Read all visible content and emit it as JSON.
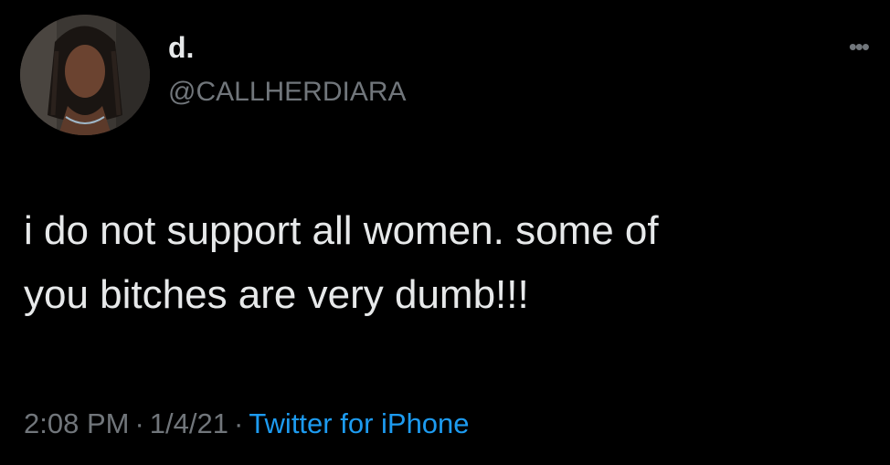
{
  "author": {
    "display_name": "d.",
    "handle": "@CALLHERDIARA"
  },
  "tweet": {
    "text": "i do not support all women. some of\nyou bitches are very dumb!!!",
    "time": "2:08 PM",
    "date": "1/4/21",
    "separator": "·",
    "source": "Twitter for iPhone"
  },
  "icons": {
    "more": "more-options-icon"
  },
  "colors": {
    "background": "#000000",
    "primary_text": "#e7e9ea",
    "secondary_text": "#71767b",
    "link": "#1d9bf0"
  }
}
